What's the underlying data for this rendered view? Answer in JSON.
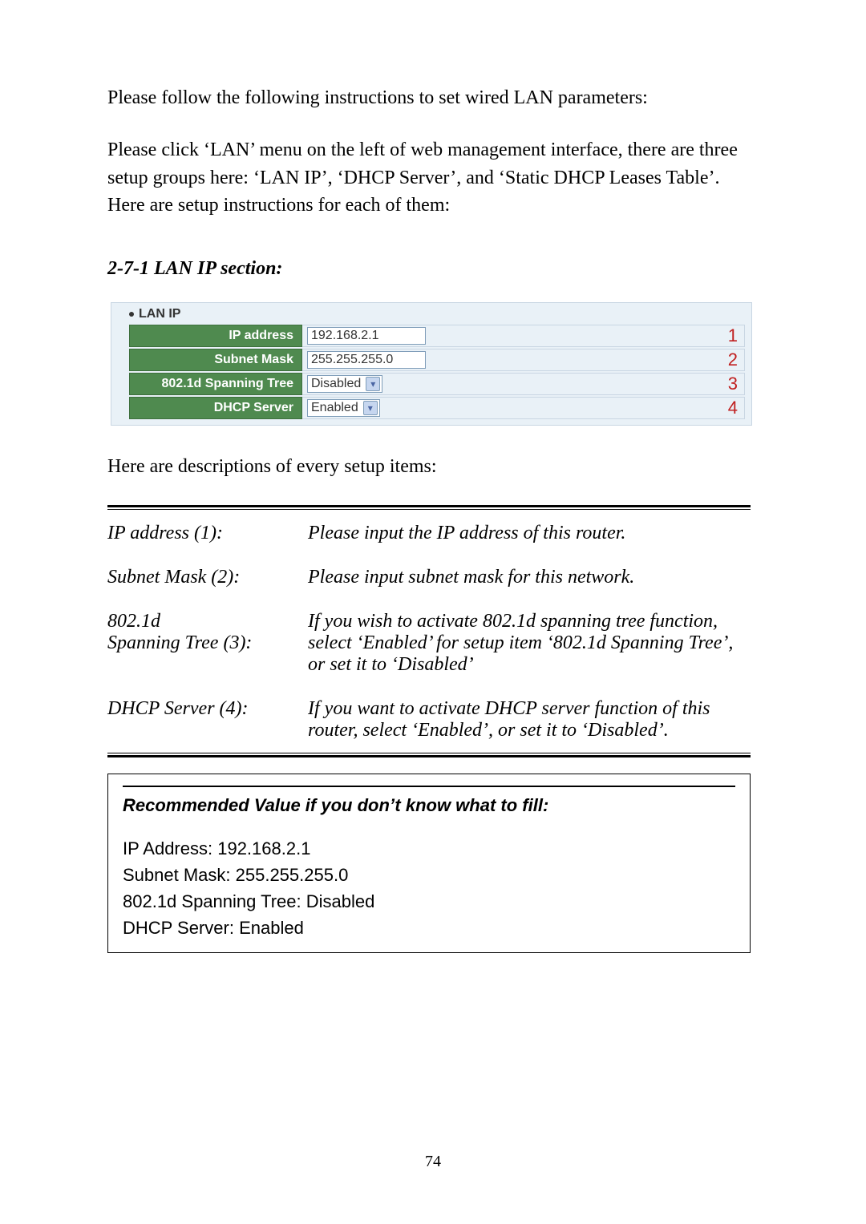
{
  "intro": {
    "p1": "Please follow the following instructions to set wired LAN parameters:",
    "p2": "Please click ‘LAN’ menu on the left of web management interface, there are three setup groups here: ‘LAN IP’, ‘DHCP Server’, and ‘Static DHCP Leases Table’. Here are setup instructions for each of them:"
  },
  "section_heading": "2-7-1 LAN IP section:",
  "lan_panel": {
    "title": "LAN IP",
    "rows": {
      "ip": {
        "label": "IP address",
        "value": "192.168.2.1",
        "num": "1"
      },
      "mask": {
        "label": "Subnet Mask",
        "value": "255.255.255.0",
        "num": "2"
      },
      "stp": {
        "label": "802.1d Spanning Tree",
        "value": "Disabled",
        "num": "3"
      },
      "dhcp": {
        "label": "DHCP Server",
        "value": "Enabled",
        "num": "4"
      }
    }
  },
  "desc_lead": "Here are descriptions of every setup items:",
  "desc": {
    "ip": {
      "term": "IP address (1):",
      "def": "Please input the IP address of this router."
    },
    "mask": {
      "term": "Subnet Mask (2):",
      "def": "Please input subnet mask for this network."
    },
    "stp": {
      "term_a": "802.1d",
      "term_b": "Spanning Tree (3):",
      "def": "If you wish to activate 802.1d spanning tree function, select ‘Enabled’ for setup item ‘802.1d Spanning Tree’, or set it to ‘Disabled’"
    },
    "dhcp": {
      "term": "DHCP Server (4):",
      "def": "If you want to activate DHCP server function of this router, select ‘Enabled’, or set it to ‘Disabled’."
    }
  },
  "recommend": {
    "title": "Recommended Value if you don’t know what to fill:",
    "lines": {
      "ip": "IP Address: 192.168.2.1",
      "mask": "Subnet Mask: 255.255.255.0",
      "stp": "802.1d Spanning Tree: Disabled",
      "dhcp": "DHCP Server: Enabled"
    }
  },
  "page_number": "74"
}
